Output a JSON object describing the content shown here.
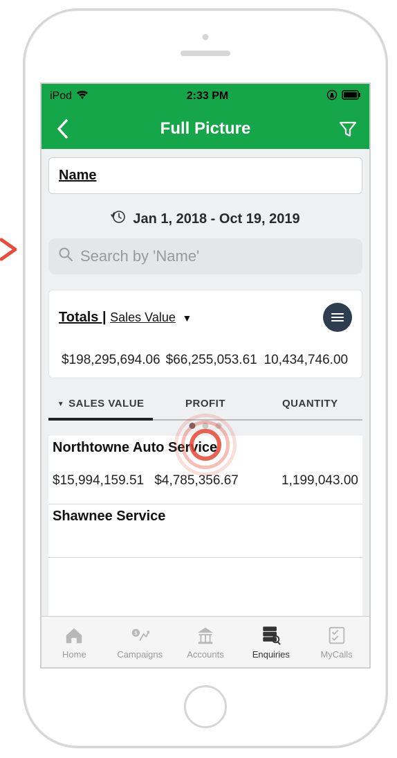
{
  "status": {
    "carrier": "iPod",
    "time": "2:33 PM"
  },
  "header": {
    "title": "Full Picture"
  },
  "name_field": {
    "label": "Name"
  },
  "date_range": "Jan 1, 2018 - Oct 19, 2019",
  "search": {
    "placeholder": "Search by 'Name'"
  },
  "totals": {
    "title_prefix": "Totals |",
    "title_metric": "Sales Value",
    "values": [
      "$198,295,694.06",
      "$66,255,053.61",
      "10,434,746.00"
    ]
  },
  "tabs": [
    "SALES VALUE",
    "PROFIT",
    "QUANTITY"
  ],
  "rows": [
    {
      "name": "Northtowne Auto Service",
      "values": [
        "$15,994,159.51",
        "$4,785,356.67",
        "1,199,043.00"
      ]
    },
    {
      "name": "Shawnee Service",
      "values": [
        "",
        "",
        ""
      ]
    }
  ],
  "bottom_nav": {
    "items": [
      {
        "label": "Home"
      },
      {
        "label": "Campaigns"
      },
      {
        "label": "Accounts"
      },
      {
        "label": "Enquiries"
      },
      {
        "label": "MyCalls"
      }
    ]
  }
}
